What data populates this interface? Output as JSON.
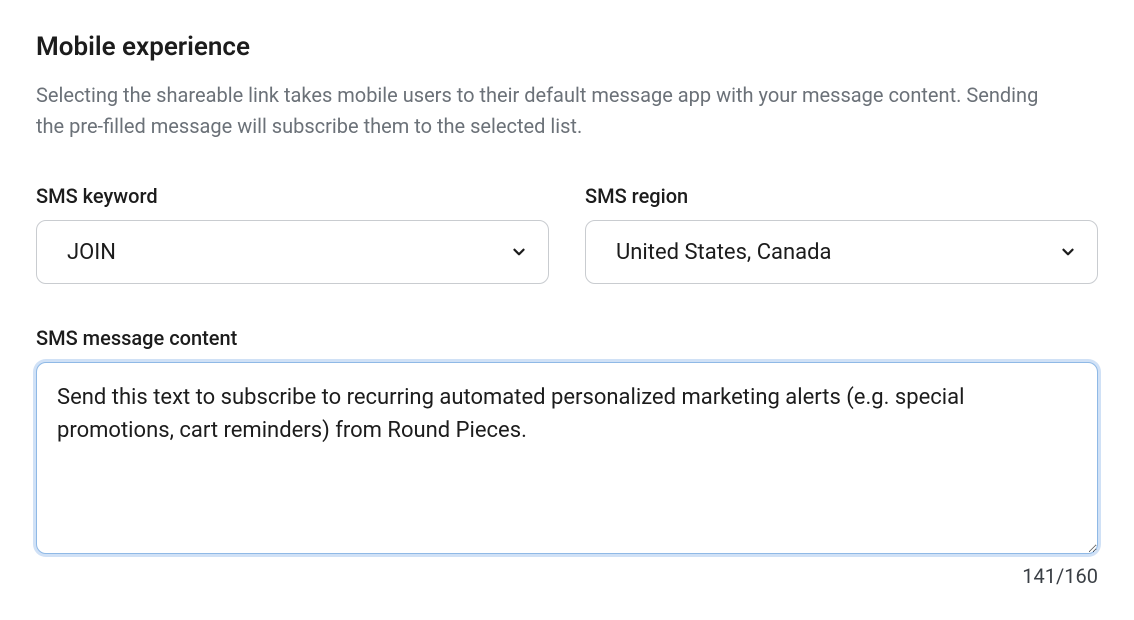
{
  "section": {
    "title": "Mobile experience",
    "description": "Selecting the shareable link takes mobile users to their default message app with your message content. Sending the pre-filled message will subscribe them to the selected list."
  },
  "fields": {
    "keyword": {
      "label": "SMS keyword",
      "value": "JOIN"
    },
    "region": {
      "label": "SMS region",
      "value": "United States, Canada"
    },
    "message": {
      "label": "SMS message content",
      "value": "Send this text to subscribe to recurring automated personalized marketing alerts (e.g. special promotions, cart reminders) from Round Pieces.",
      "count": "141/160"
    }
  }
}
